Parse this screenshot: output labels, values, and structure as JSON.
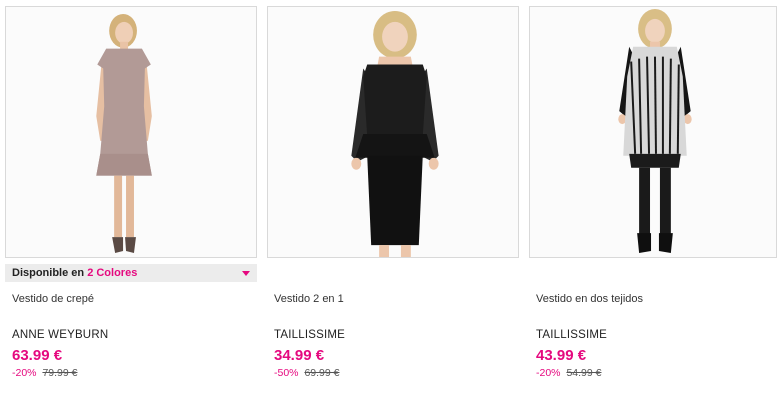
{
  "products": [
    {
      "name": "Vestido de crepé",
      "brand": "ANNE WEYBURN",
      "price": "63.99 €",
      "discount": "-20%",
      "old_price": "79.99 €",
      "colors_label": "Disponible en",
      "colors_count": "2 Colores",
      "image_icon": "model-in-taupe-dress",
      "dress_color": "#b29a96"
    },
    {
      "name": "Vestido 2 en 1",
      "brand": "TAILLISSIME",
      "price": "34.99 €",
      "discount": "-50%",
      "old_price": "69.99 €",
      "image_icon": "model-in-black-lace-dress",
      "dress_color": "#141414"
    },
    {
      "name": "Vestido en dos tejidos",
      "brand": "TAILLISSIME",
      "price": "43.99 €",
      "discount": "-20%",
      "old_price": "54.99 €",
      "image_icon": "model-in-print-dress",
      "dress_color": "#1b1b1b"
    }
  ],
  "colors": {
    "accent": "#e5097f",
    "bar_bg": "#ececec",
    "border": "#d9d9d9"
  }
}
